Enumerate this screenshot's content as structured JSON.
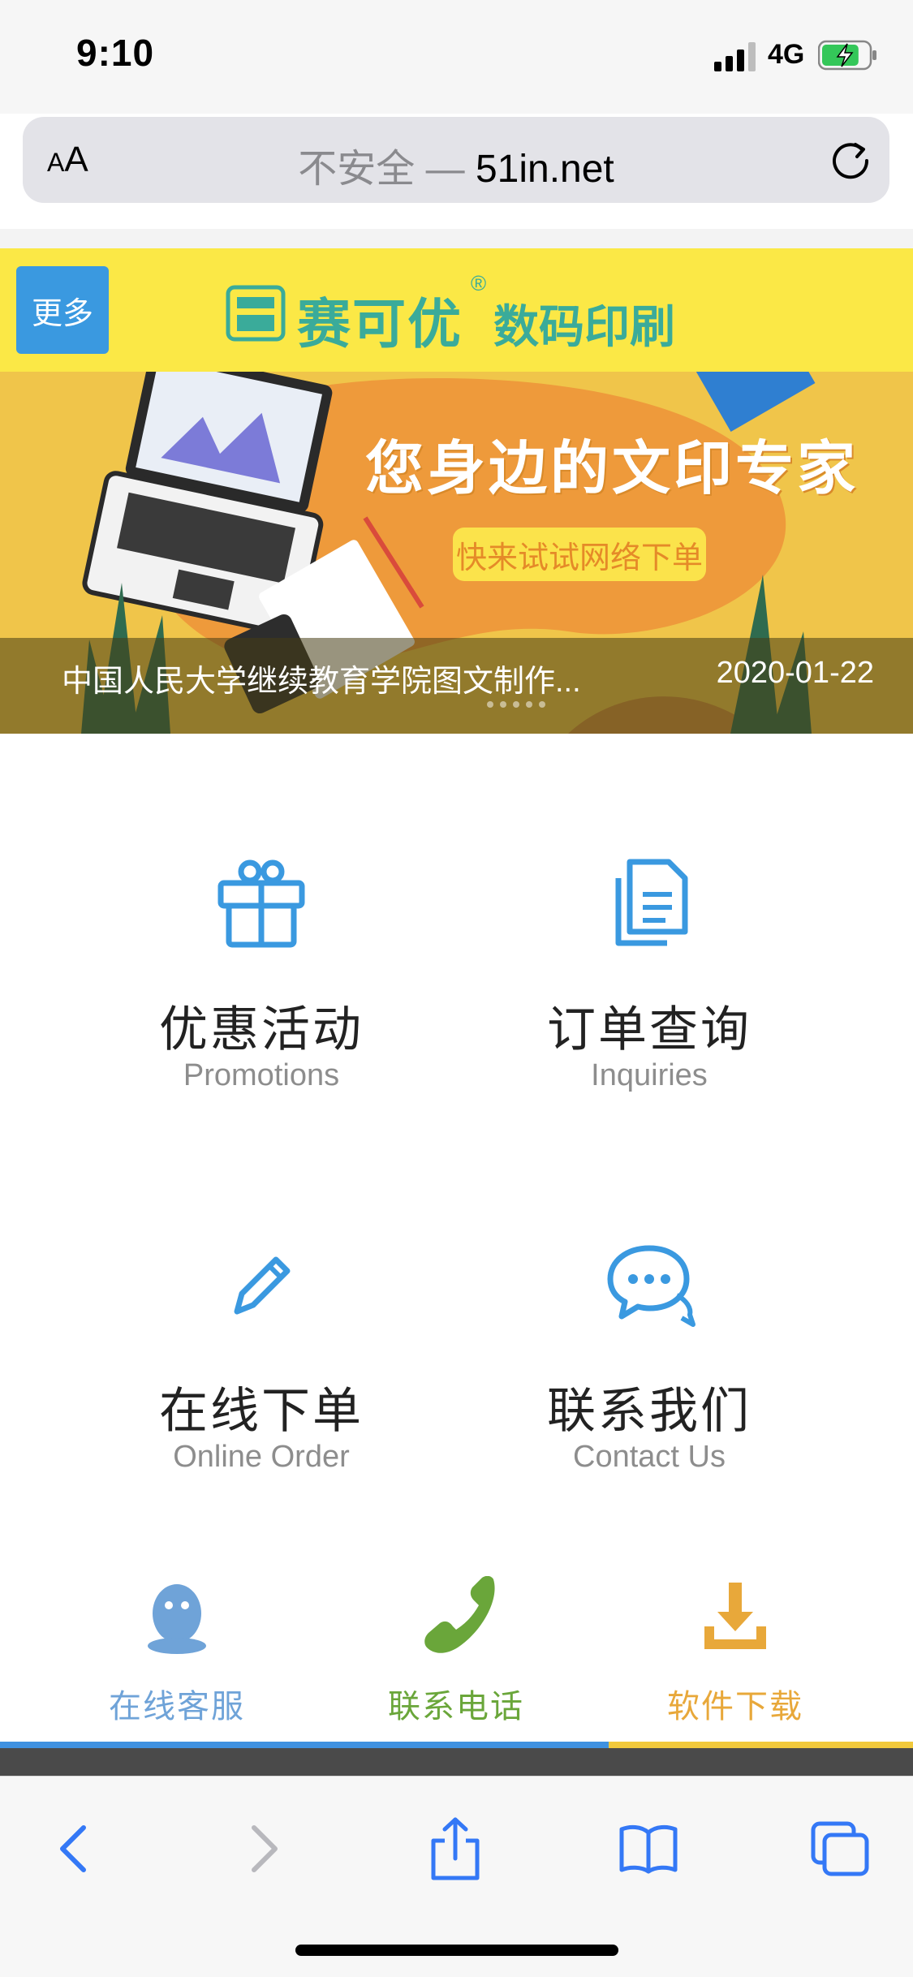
{
  "status_bar": {
    "time": "9:10",
    "network": "4G",
    "battery_level": 0.8
  },
  "url_bar": {
    "text_size_label_small": "A",
    "text_size_label": "A",
    "insecure_label": "不安全 —",
    "domain": "51in.net"
  },
  "header": {
    "more_button": "更多",
    "brand_name": "赛可优",
    "brand_reg": "®",
    "brand_tagline": "数码印刷"
  },
  "banner": {
    "headline": "您身边的文印专家",
    "cta": "快来试试网络下单",
    "caption": "中国人民大学继续教育学院图文制作...",
    "date": "2020-01-22"
  },
  "features": [
    {
      "title": "优惠活动",
      "subtitle": "Promotions",
      "icon": "gift-icon"
    },
    {
      "title": "订单查询",
      "subtitle": "Inquiries",
      "icon": "document-icon"
    },
    {
      "title": "在线下单",
      "subtitle": "Online Order",
      "icon": "pencil-icon"
    },
    {
      "title": "联系我们",
      "subtitle": "Contact Us",
      "icon": "chat-icon"
    }
  ],
  "quick_actions": [
    {
      "label": "在线客服",
      "icon": "qq-penguin-icon",
      "color": "#6fa3d8"
    },
    {
      "label": "联系电话",
      "icon": "phone-icon",
      "color": "#6aa63a"
    },
    {
      "label": "软件下载",
      "icon": "download-icon",
      "color": "#e8a83a"
    }
  ],
  "scroll_progress": 0.667,
  "colors": {
    "accent_blue": "#3a99e0",
    "brand_teal": "#3aab9a",
    "header_yellow": "#fbe846",
    "safari_blue": "#3478f6"
  }
}
